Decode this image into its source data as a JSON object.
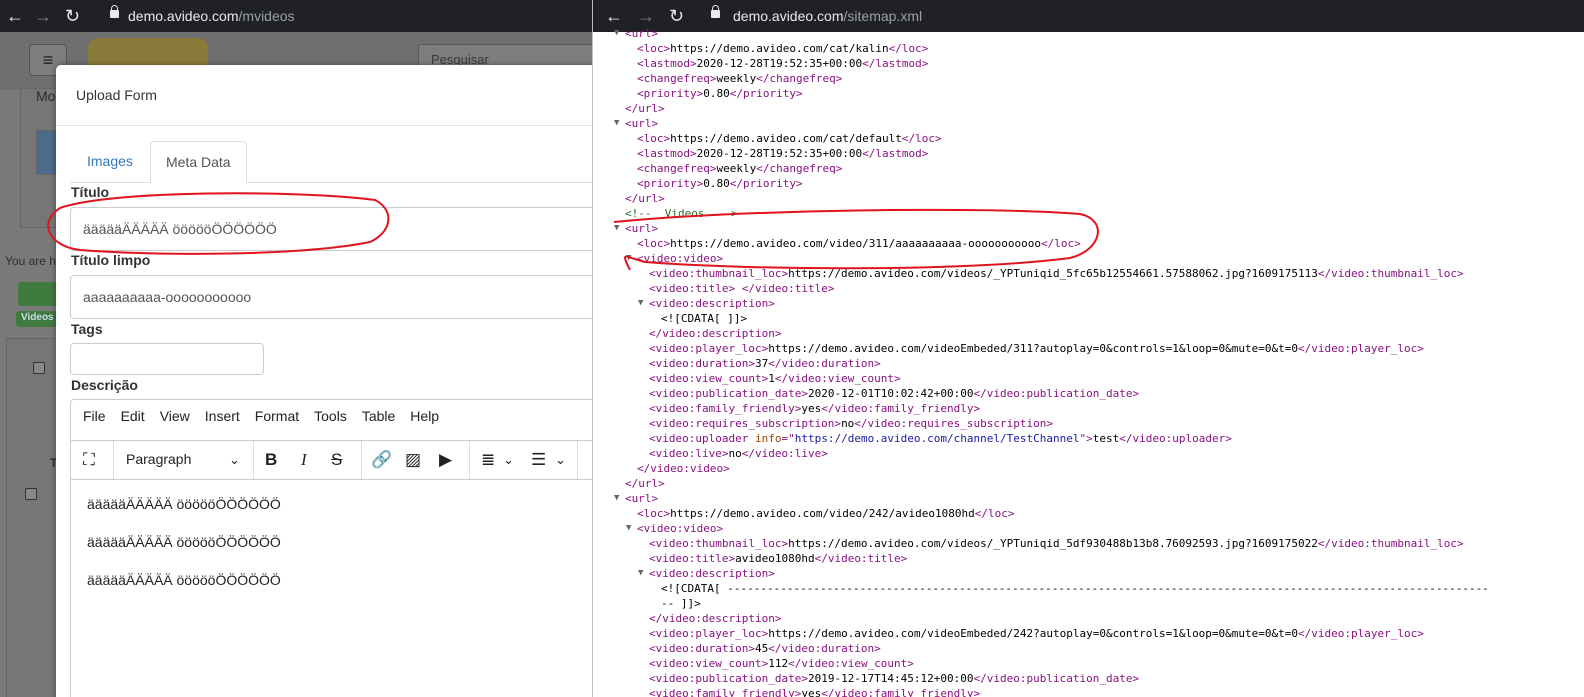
{
  "left_browser": {
    "url_host": "demo.avideo.com",
    "url_path": "/mvideos"
  },
  "right_browser": {
    "url_host": "demo.avideo.com",
    "url_path": "/sitemap.xml"
  },
  "background_page": {
    "search_placeholder": "Pesquisar",
    "frag_mo": "Mo",
    "frag_you_are": "You are h",
    "frag_videos": "Videos",
    "frag_t": "T"
  },
  "upload_form": {
    "title": "Upload Form",
    "tabs": [
      {
        "label": "Images",
        "active": false
      },
      {
        "label": "Meta Data",
        "active": true
      }
    ],
    "titulo_label": "Título",
    "titulo_value": "äääääÄÄÄÄÄ öööööÖÖÖÖÖÖ",
    "titulo_limpo_label": "Título limpo",
    "titulo_limpo_value": "aaaaaaaaaa-ooooooooooo",
    "tags_label": "Tags",
    "tags_value": "",
    "descricao_label": "Descrição",
    "editor": {
      "menu": [
        "File",
        "Edit",
        "View",
        "Insert",
        "Format",
        "Tools",
        "Table",
        "Help"
      ],
      "paragraph_select": "Paragraph",
      "content_lines": [
        "äääääÄÄÄÄÄ öööööÖÖÖÖÖÖ",
        "äääääÄÄÄÄÄ öööööÖÖÖÖÖÖ",
        "äääääÄÄÄÄÄ öööööÖÖÖÖÖÖ"
      ]
    }
  },
  "sitemap_lines": [
    {
      "indent": 0,
      "arrow": true,
      "parts": [
        {
          "c": "tag",
          "t": "<url>"
        }
      ]
    },
    {
      "indent": 1,
      "parts": [
        {
          "c": "tag",
          "t": "<loc>"
        },
        {
          "c": "txt",
          "t": "https://demo.avideo.com/cat/kalin"
        },
        {
          "c": "tag",
          "t": "</loc>"
        }
      ]
    },
    {
      "indent": 1,
      "parts": [
        {
          "c": "tag",
          "t": "<lastmod>"
        },
        {
          "c": "txt",
          "t": "2020-12-28T19:52:35+00:00"
        },
        {
          "c": "tag",
          "t": "</lastmod>"
        }
      ]
    },
    {
      "indent": 1,
      "parts": [
        {
          "c": "tag",
          "t": "<changefreq>"
        },
        {
          "c": "txt",
          "t": "weekly"
        },
        {
          "c": "tag",
          "t": "</changefreq>"
        }
      ]
    },
    {
      "indent": 1,
      "parts": [
        {
          "c": "tag",
          "t": "<priority>"
        },
        {
          "c": "txt",
          "t": "0.80"
        },
        {
          "c": "tag",
          "t": "</priority>"
        }
      ]
    },
    {
      "indent": 0,
      "parts": [
        {
          "c": "tag",
          "t": "</url>"
        }
      ]
    },
    {
      "indent": 0,
      "arrow": true,
      "parts": [
        {
          "c": "tag",
          "t": "<url>"
        }
      ]
    },
    {
      "indent": 1,
      "parts": [
        {
          "c": "tag",
          "t": "<loc>"
        },
        {
          "c": "txt",
          "t": "https://demo.avideo.com/cat/default"
        },
        {
          "c": "tag",
          "t": "</loc>"
        }
      ]
    },
    {
      "indent": 1,
      "parts": [
        {
          "c": "tag",
          "t": "<lastmod>"
        },
        {
          "c": "txt",
          "t": "2020-12-28T19:52:35+00:00"
        },
        {
          "c": "tag",
          "t": "</lastmod>"
        }
      ]
    },
    {
      "indent": 1,
      "parts": [
        {
          "c": "tag",
          "t": "<changefreq>"
        },
        {
          "c": "txt",
          "t": "weekly"
        },
        {
          "c": "tag",
          "t": "</changefreq>"
        }
      ]
    },
    {
      "indent": 1,
      "parts": [
        {
          "c": "tag",
          "t": "<priority>"
        },
        {
          "c": "txt",
          "t": "0.80"
        },
        {
          "c": "tag",
          "t": "</priority>"
        }
      ]
    },
    {
      "indent": 0,
      "parts": [
        {
          "c": "tag",
          "t": "</url>"
        }
      ]
    },
    {
      "indent": 0,
      "parts": [
        {
          "c": "cmt",
          "t": "<!--  Videos  -->"
        }
      ]
    },
    {
      "indent": 0,
      "arrow": true,
      "parts": [
        {
          "c": "tag",
          "t": "<url>"
        }
      ]
    },
    {
      "indent": 1,
      "parts": [
        {
          "c": "tag",
          "t": "<loc>"
        },
        {
          "c": "txt",
          "t": "https://demo.avideo.com/video/311/aaaaaaaaaa-ooooooooooo"
        },
        {
          "c": "tag",
          "t": "</loc>"
        }
      ]
    },
    {
      "indent": 1,
      "arrow": true,
      "parts": [
        {
          "c": "tag",
          "t": "<video:video>"
        }
      ]
    },
    {
      "indent": 2,
      "parts": [
        {
          "c": "tag",
          "t": "<video:thumbnail_loc>"
        },
        {
          "c": "txt",
          "t": "https://demo.avideo.com/videos/_YPTuniqid_5fc65b12554661.57588062.jpg?1609175113"
        },
        {
          "c": "tag",
          "t": "</video:thumbnail_loc>"
        }
      ]
    },
    {
      "indent": 2,
      "parts": [
        {
          "c": "tag",
          "t": "<video:title>"
        },
        {
          "c": "txt",
          "t": " "
        },
        {
          "c": "tag",
          "t": "</video:title>"
        }
      ]
    },
    {
      "indent": 2,
      "arrow": true,
      "parts": [
        {
          "c": "tag",
          "t": "<video:description>"
        }
      ]
    },
    {
      "indent": 3,
      "parts": [
        {
          "c": "txt",
          "t": "<![CDATA[ ]]>"
        }
      ]
    },
    {
      "indent": 2,
      "parts": [
        {
          "c": "tag",
          "t": "</video:description>"
        }
      ]
    },
    {
      "indent": 2,
      "parts": [
        {
          "c": "tag",
          "t": "<video:player_loc>"
        },
        {
          "c": "txt",
          "t": "https://demo.avideo.com/videoEmbeded/311?autoplay=0&controls=1&loop=0&mute=0&t=0"
        },
        {
          "c": "tag",
          "t": "</video:player_loc>"
        }
      ]
    },
    {
      "indent": 2,
      "parts": [
        {
          "c": "tag",
          "t": "<video:duration>"
        },
        {
          "c": "txt",
          "t": "37"
        },
        {
          "c": "tag",
          "t": "</video:duration>"
        }
      ]
    },
    {
      "indent": 2,
      "parts": [
        {
          "c": "tag",
          "t": "<video:view_count>"
        },
        {
          "c": "txt",
          "t": "1"
        },
        {
          "c": "tag",
          "t": "</video:view_count>"
        }
      ]
    },
    {
      "indent": 2,
      "parts": [
        {
          "c": "tag",
          "t": "<video:publication_date>"
        },
        {
          "c": "txt",
          "t": "2020-12-01T10:02:42+00:00"
        },
        {
          "c": "tag",
          "t": "</video:publication_date>"
        }
      ]
    },
    {
      "indent": 2,
      "parts": [
        {
          "c": "tag",
          "t": "<video:family_friendly>"
        },
        {
          "c": "txt",
          "t": "yes"
        },
        {
          "c": "tag",
          "t": "</video:family_friendly>"
        }
      ]
    },
    {
      "indent": 2,
      "parts": [
        {
          "c": "tag",
          "t": "<video:requires_subscription>"
        },
        {
          "c": "txt",
          "t": "no"
        },
        {
          "c": "tag",
          "t": "</video:requires_subscription>"
        }
      ]
    },
    {
      "indent": 2,
      "parts": [
        {
          "c": "tag",
          "t": "<video:uploader "
        },
        {
          "c": "attr",
          "t": "info"
        },
        {
          "c": "tag",
          "t": "=\""
        },
        {
          "c": "aval",
          "t": "https://demo.avideo.com/channel/TestChannel"
        },
        {
          "c": "tag",
          "t": "\">"
        },
        {
          "c": "txt",
          "t": "test"
        },
        {
          "c": "tag",
          "t": "</video:uploader>"
        }
      ]
    },
    {
      "indent": 2,
      "parts": [
        {
          "c": "tag",
          "t": "<video:live>"
        },
        {
          "c": "txt",
          "t": "no"
        },
        {
          "c": "tag",
          "t": "</video:live>"
        }
      ]
    },
    {
      "indent": 1,
      "parts": [
        {
          "c": "tag",
          "t": "</video:video>"
        }
      ]
    },
    {
      "indent": 0,
      "parts": [
        {
          "c": "tag",
          "t": "</url>"
        }
      ]
    },
    {
      "indent": 0,
      "arrow": true,
      "parts": [
        {
          "c": "tag",
          "t": "<url>"
        }
      ]
    },
    {
      "indent": 1,
      "parts": [
        {
          "c": "tag",
          "t": "<loc>"
        },
        {
          "c": "txt",
          "t": "https://demo.avideo.com/video/242/avideo1080hd"
        },
        {
          "c": "tag",
          "t": "</loc>"
        }
      ]
    },
    {
      "indent": 1,
      "arrow": true,
      "parts": [
        {
          "c": "tag",
          "t": "<video:video>"
        }
      ]
    },
    {
      "indent": 2,
      "parts": [
        {
          "c": "tag",
          "t": "<video:thumbnail_loc>"
        },
        {
          "c": "txt",
          "t": "https://demo.avideo.com/videos/_YPTuniqid_5df930488b13b8.76092593.jpg?1609175022"
        },
        {
          "c": "tag",
          "t": "</video:thumbnail_loc>"
        }
      ]
    },
    {
      "indent": 2,
      "parts": [
        {
          "c": "tag",
          "t": "<video:title>"
        },
        {
          "c": "txt",
          "t": "avideo1080hd"
        },
        {
          "c": "tag",
          "t": "</video:title>"
        }
      ]
    },
    {
      "indent": 2,
      "arrow": true,
      "parts": [
        {
          "c": "tag",
          "t": "<video:description>"
        }
      ]
    },
    {
      "indent": 3,
      "parts": [
        {
          "c": "txt",
          "t": "<![CDATA[ -------------------------------------------------------------------------------------------------------------------"
        }
      ]
    },
    {
      "indent": 3,
      "parts": [
        {
          "c": "txt",
          "t": "-- ]]>"
        }
      ]
    },
    {
      "indent": 2,
      "parts": [
        {
          "c": "tag",
          "t": "</video:description>"
        }
      ]
    },
    {
      "indent": 2,
      "parts": [
        {
          "c": "tag",
          "t": "<video:player_loc>"
        },
        {
          "c": "txt",
          "t": "https://demo.avideo.com/videoEmbeded/242?autoplay=0&controls=1&loop=0&mute=0&t=0"
        },
        {
          "c": "tag",
          "t": "</video:player_loc>"
        }
      ]
    },
    {
      "indent": 2,
      "parts": [
        {
          "c": "tag",
          "t": "<video:duration>"
        },
        {
          "c": "txt",
          "t": "45"
        },
        {
          "c": "tag",
          "t": "</video:duration>"
        }
      ]
    },
    {
      "indent": 2,
      "parts": [
        {
          "c": "tag",
          "t": "<video:view_count>"
        },
        {
          "c": "txt",
          "t": "112"
        },
        {
          "c": "tag",
          "t": "</video:view_count>"
        }
      ]
    },
    {
      "indent": 2,
      "parts": [
        {
          "c": "tag",
          "t": "<video:publication_date>"
        },
        {
          "c": "txt",
          "t": "2019-12-17T14:45:12+00:00"
        },
        {
          "c": "tag",
          "t": "</video:publication_date>"
        }
      ]
    },
    {
      "indent": 2,
      "parts": [
        {
          "c": "tag",
          "t": "<video:family_friendly>"
        },
        {
          "c": "txt",
          "t": "yes"
        },
        {
          "c": "tag",
          "t": "</video:family_friendly>"
        }
      ]
    }
  ],
  "colors": {
    "annotation": "#e0141e",
    "tag": "#881280",
    "link": "#337ab7"
  }
}
